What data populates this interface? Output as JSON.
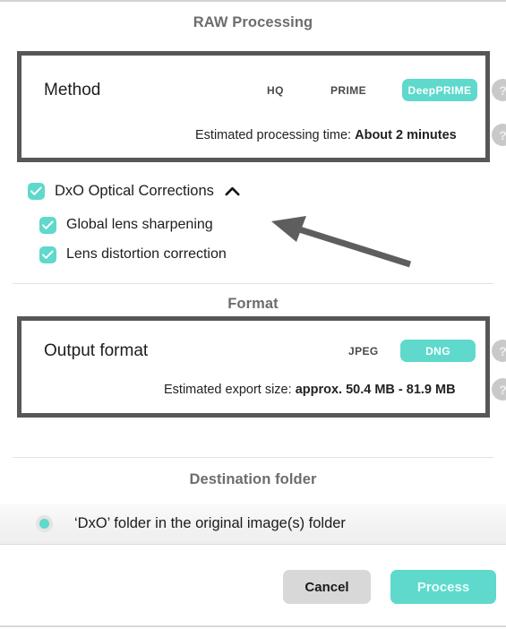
{
  "sections": {
    "raw_processing": {
      "title": "RAW Processing",
      "method_label": "Method",
      "method_options": [
        {
          "label": "HQ",
          "selected": false
        },
        {
          "label": "PRIME",
          "selected": false
        },
        {
          "label": "DeepPRIME",
          "selected": true
        }
      ],
      "estimate_label": "Estimated processing time:",
      "estimate_value": "About 2 minutes",
      "help_icon": "question-mark-icon"
    },
    "optical_corrections": {
      "parent": {
        "label": "DxO Optical Corrections",
        "checked": true
      },
      "collapse_icon": "chevron-up-icon",
      "children": [
        {
          "label": "Global lens sharpening",
          "checked": true
        },
        {
          "label": "Lens distortion correction",
          "checked": true
        }
      ]
    },
    "format": {
      "title": "Format",
      "output_label": "Output format",
      "output_options": [
        {
          "label": "JPEG",
          "selected": false
        },
        {
          "label": "DNG",
          "selected": true
        }
      ],
      "estimate_label": "Estimated export size:",
      "estimate_value": "approx. 50.4 MB - 81.9 MB",
      "help_icon": "question-mark-icon"
    },
    "destination": {
      "title": "Destination folder",
      "option_label": "‘DxO’ folder in the original image(s) folder",
      "selected": true
    }
  },
  "footer": {
    "cancel_label": "Cancel",
    "process_label": "Process"
  },
  "annotations": {
    "arrow": "pointer-arrow-annotation",
    "highlight_boxes": [
      "method-highlight-frame",
      "format-highlight-frame"
    ]
  },
  "colors": {
    "accent_teal": "#5ed9cc",
    "frame_gray": "#575757",
    "header_gray": "#6d6d6d",
    "help_gray": "#c9c9c9",
    "cancel_gray": "#d8d8d8"
  },
  "icons": {
    "check": "check-icon",
    "chevron_up": "chevron-up-icon",
    "help": "question-mark-icon",
    "radio_selected": "radio-selected-icon"
  }
}
